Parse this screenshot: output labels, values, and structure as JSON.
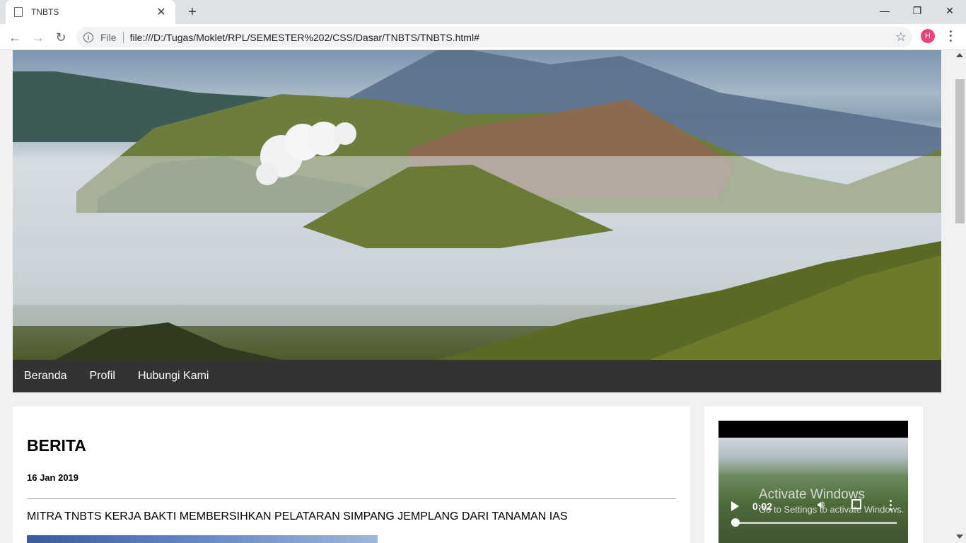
{
  "browser": {
    "tab_title": "TNBTS",
    "scheme_label": "File",
    "url": "file:///D:/Tugas/Moklet/RPL/SEMESTER%202/CSS/Dasar/TNBTS/TNBTS.html#",
    "profile_initial": "H",
    "icons": [
      "document-icon",
      "close-icon",
      "plus-icon",
      "back-icon",
      "forward-icon",
      "reload-icon",
      "info-icon",
      "star-icon",
      "minimize-icon",
      "maximize-icon",
      "window-close-icon",
      "menu-icon"
    ]
  },
  "nav": {
    "items": [
      "Beranda",
      "Profil",
      "Hubungi Kami"
    ]
  },
  "article": {
    "heading": "BERITA",
    "date": "16 Jan 2019",
    "headline": "MITRA TNBTS KERJA BAKTI MEMBERSIHKAN PELATARAN SIMPANG JEMPLANG DARI TANAMAN IAS"
  },
  "video": {
    "time": "0:02",
    "progress_fraction": 0.02
  },
  "watermark": {
    "line1": "Activate Windows",
    "line2": "Go to Settings to activate Windows."
  },
  "colors": {
    "menubar": "#333333",
    "avatar": "#e8437a",
    "page_background": "#f1f1f1"
  }
}
